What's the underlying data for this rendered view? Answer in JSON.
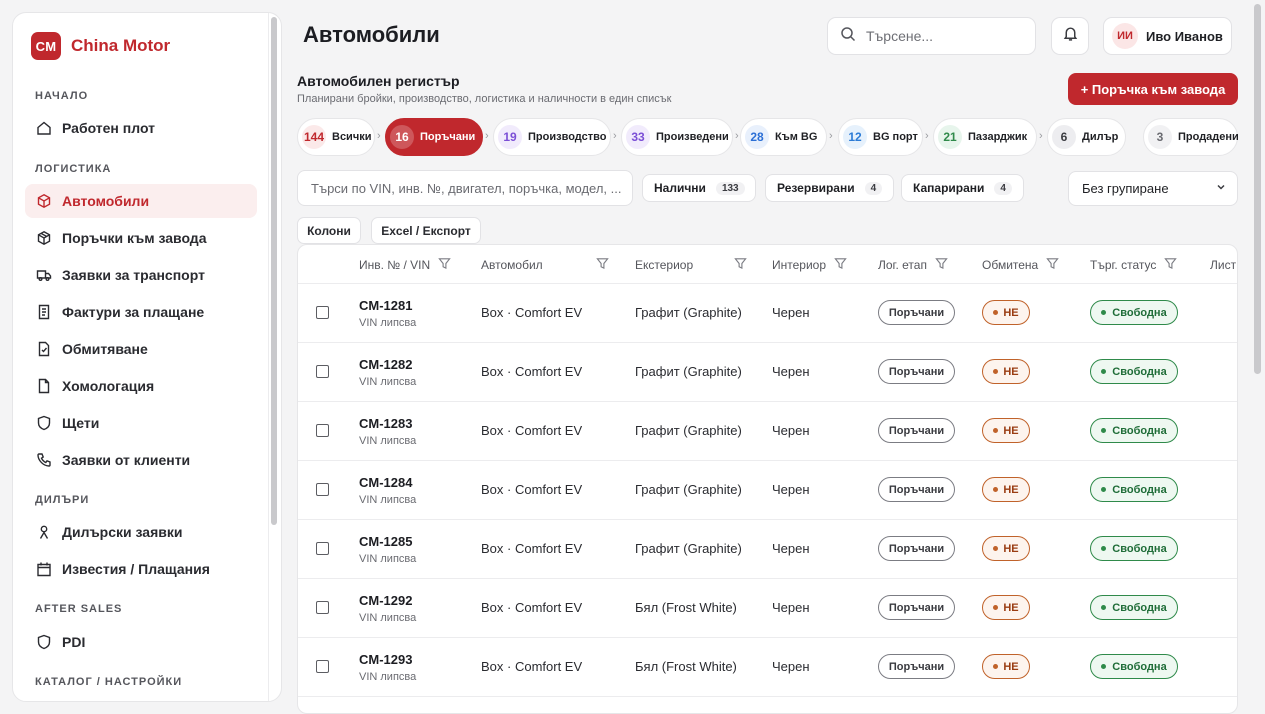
{
  "brand": {
    "logo": "CM",
    "name": "China Motor"
  },
  "sidebar": {
    "sections": [
      {
        "title": "НАЧАЛО"
      },
      {
        "title": "ЛОГИСТИКА"
      },
      {
        "title": "ДИЛЪРИ"
      },
      {
        "title": "AFTER SALES"
      },
      {
        "title": "КАТАЛОГ / НАСТРОЙКИ"
      }
    ],
    "items": [
      {
        "label": "Работен плот",
        "icon": "home-icon"
      },
      {
        "label": "Автомобили",
        "icon": "box-icon"
      },
      {
        "label": "Поръчки към завода",
        "icon": "package-icon"
      },
      {
        "label": "Заявки за транспорт",
        "icon": "truck-icon"
      },
      {
        "label": "Фактури за плащане",
        "icon": "receipt-icon"
      },
      {
        "label": "Обмитяване",
        "icon": "file-check-icon"
      },
      {
        "label": "Хомологация",
        "icon": "file-icon"
      },
      {
        "label": "Щети",
        "icon": "shield-icon"
      },
      {
        "label": "Заявки от клиенти",
        "icon": "phone-icon"
      },
      {
        "label": "Дилърски заявки",
        "icon": "person-icon"
      },
      {
        "label": "Известия / Плащания",
        "icon": "calendar-icon"
      },
      {
        "label": "PDI",
        "icon": "shield-icon"
      }
    ]
  },
  "header": {
    "title": "Автомобили",
    "search_placeholder": "Търсене...",
    "user_initials": "ИИ",
    "user_name": "Иво Иванов"
  },
  "registry": {
    "title": "Автомобилен регистър",
    "subtitle": "Планирани бройки, производство, логистика и наличности в един списък",
    "order_button": "+ Поръчка към завода"
  },
  "pipeline": [
    {
      "count": "144",
      "label": "Всички",
      "color": "#c0282d",
      "bg": "#fbe9e9"
    },
    {
      "count": "16",
      "label": "Поръчани",
      "color": "#ffffff",
      "bg": "#c0282d"
    },
    {
      "count": "19",
      "label": "Производство",
      "color": "#7b4ed6",
      "bg": "#f1ebfc"
    },
    {
      "count": "33",
      "label": "Произведени",
      "color": "#7b4ed6",
      "bg": "#f1ebfc"
    },
    {
      "count": "28",
      "label": "Към BG",
      "color": "#2b6fd6",
      "bg": "#e8f0fc"
    },
    {
      "count": "12",
      "label": "BG порт",
      "color": "#2b7bd6",
      "bg": "#e6f1fc"
    },
    {
      "count": "21",
      "label": "Пазарджик",
      "color": "#2f8a4a",
      "bg": "#e7f5ec"
    },
    {
      "count": "6",
      "label": "Дилър",
      "color": "#3a3b40",
      "bg": "#ededf0"
    },
    {
      "count": "3",
      "label": "Продадени",
      "color": "#6a6b71",
      "bg": "#f1f1f3"
    }
  ],
  "filters": {
    "search_placeholder": "Търси по VIN, инв. №, двигател, поръчка, модел, ...",
    "chips": [
      {
        "label": "Налични",
        "count": "133"
      },
      {
        "label": "Резервирани",
        "count": "4"
      },
      {
        "label": "Капарирани",
        "count": "4"
      }
    ],
    "grouping": "Без групиране",
    "columns_button": "Колони",
    "export_button": "Excel / Експорт"
  },
  "table": {
    "columns": [
      "Инв. № / VIN",
      "Автомобил",
      "Екстериор",
      "Интериор",
      "Лог. етап",
      "Обмитена",
      "Търг. статус",
      "Лист"
    ],
    "rows": [
      {
        "inv": "CM-1281",
        "vin": "VIN липсва",
        "car": "Box · Comfort EV",
        "exterior": "Графит (Graphite)",
        "interior": "Черен",
        "stage": "Поръчани",
        "customs": "НЕ",
        "trade": "Свободна"
      },
      {
        "inv": "CM-1282",
        "vin": "VIN липсва",
        "car": "Box · Comfort EV",
        "exterior": "Графит (Graphite)",
        "interior": "Черен",
        "stage": "Поръчани",
        "customs": "НЕ",
        "trade": "Свободна"
      },
      {
        "inv": "CM-1283",
        "vin": "VIN липсва",
        "car": "Box · Comfort EV",
        "exterior": "Графит (Graphite)",
        "interior": "Черен",
        "stage": "Поръчани",
        "customs": "НЕ",
        "trade": "Свободна"
      },
      {
        "inv": "CM-1284",
        "vin": "VIN липсва",
        "car": "Box · Comfort EV",
        "exterior": "Графит (Graphite)",
        "interior": "Черен",
        "stage": "Поръчани",
        "customs": "НЕ",
        "trade": "Свободна"
      },
      {
        "inv": "CM-1285",
        "vin": "VIN липсва",
        "car": "Box · Comfort EV",
        "exterior": "Графит (Graphite)",
        "interior": "Черен",
        "stage": "Поръчани",
        "customs": "НЕ",
        "trade": "Свободна"
      },
      {
        "inv": "CM-1292",
        "vin": "VIN липсва",
        "car": "Box · Comfort EV",
        "exterior": "Бял (Frost White)",
        "interior": "Черен",
        "stage": "Поръчани",
        "customs": "НЕ",
        "trade": "Свободна"
      },
      {
        "inv": "CM-1293",
        "vin": "VIN липсва",
        "car": "Box · Comfort EV",
        "exterior": "Бял (Frost White)",
        "interior": "Черен",
        "stage": "Поръчани",
        "customs": "НЕ",
        "trade": "Свободна"
      }
    ]
  },
  "colors": {
    "accent": "#c0282d",
    "success": "#2f8a4a",
    "warning": "#c0622a"
  }
}
